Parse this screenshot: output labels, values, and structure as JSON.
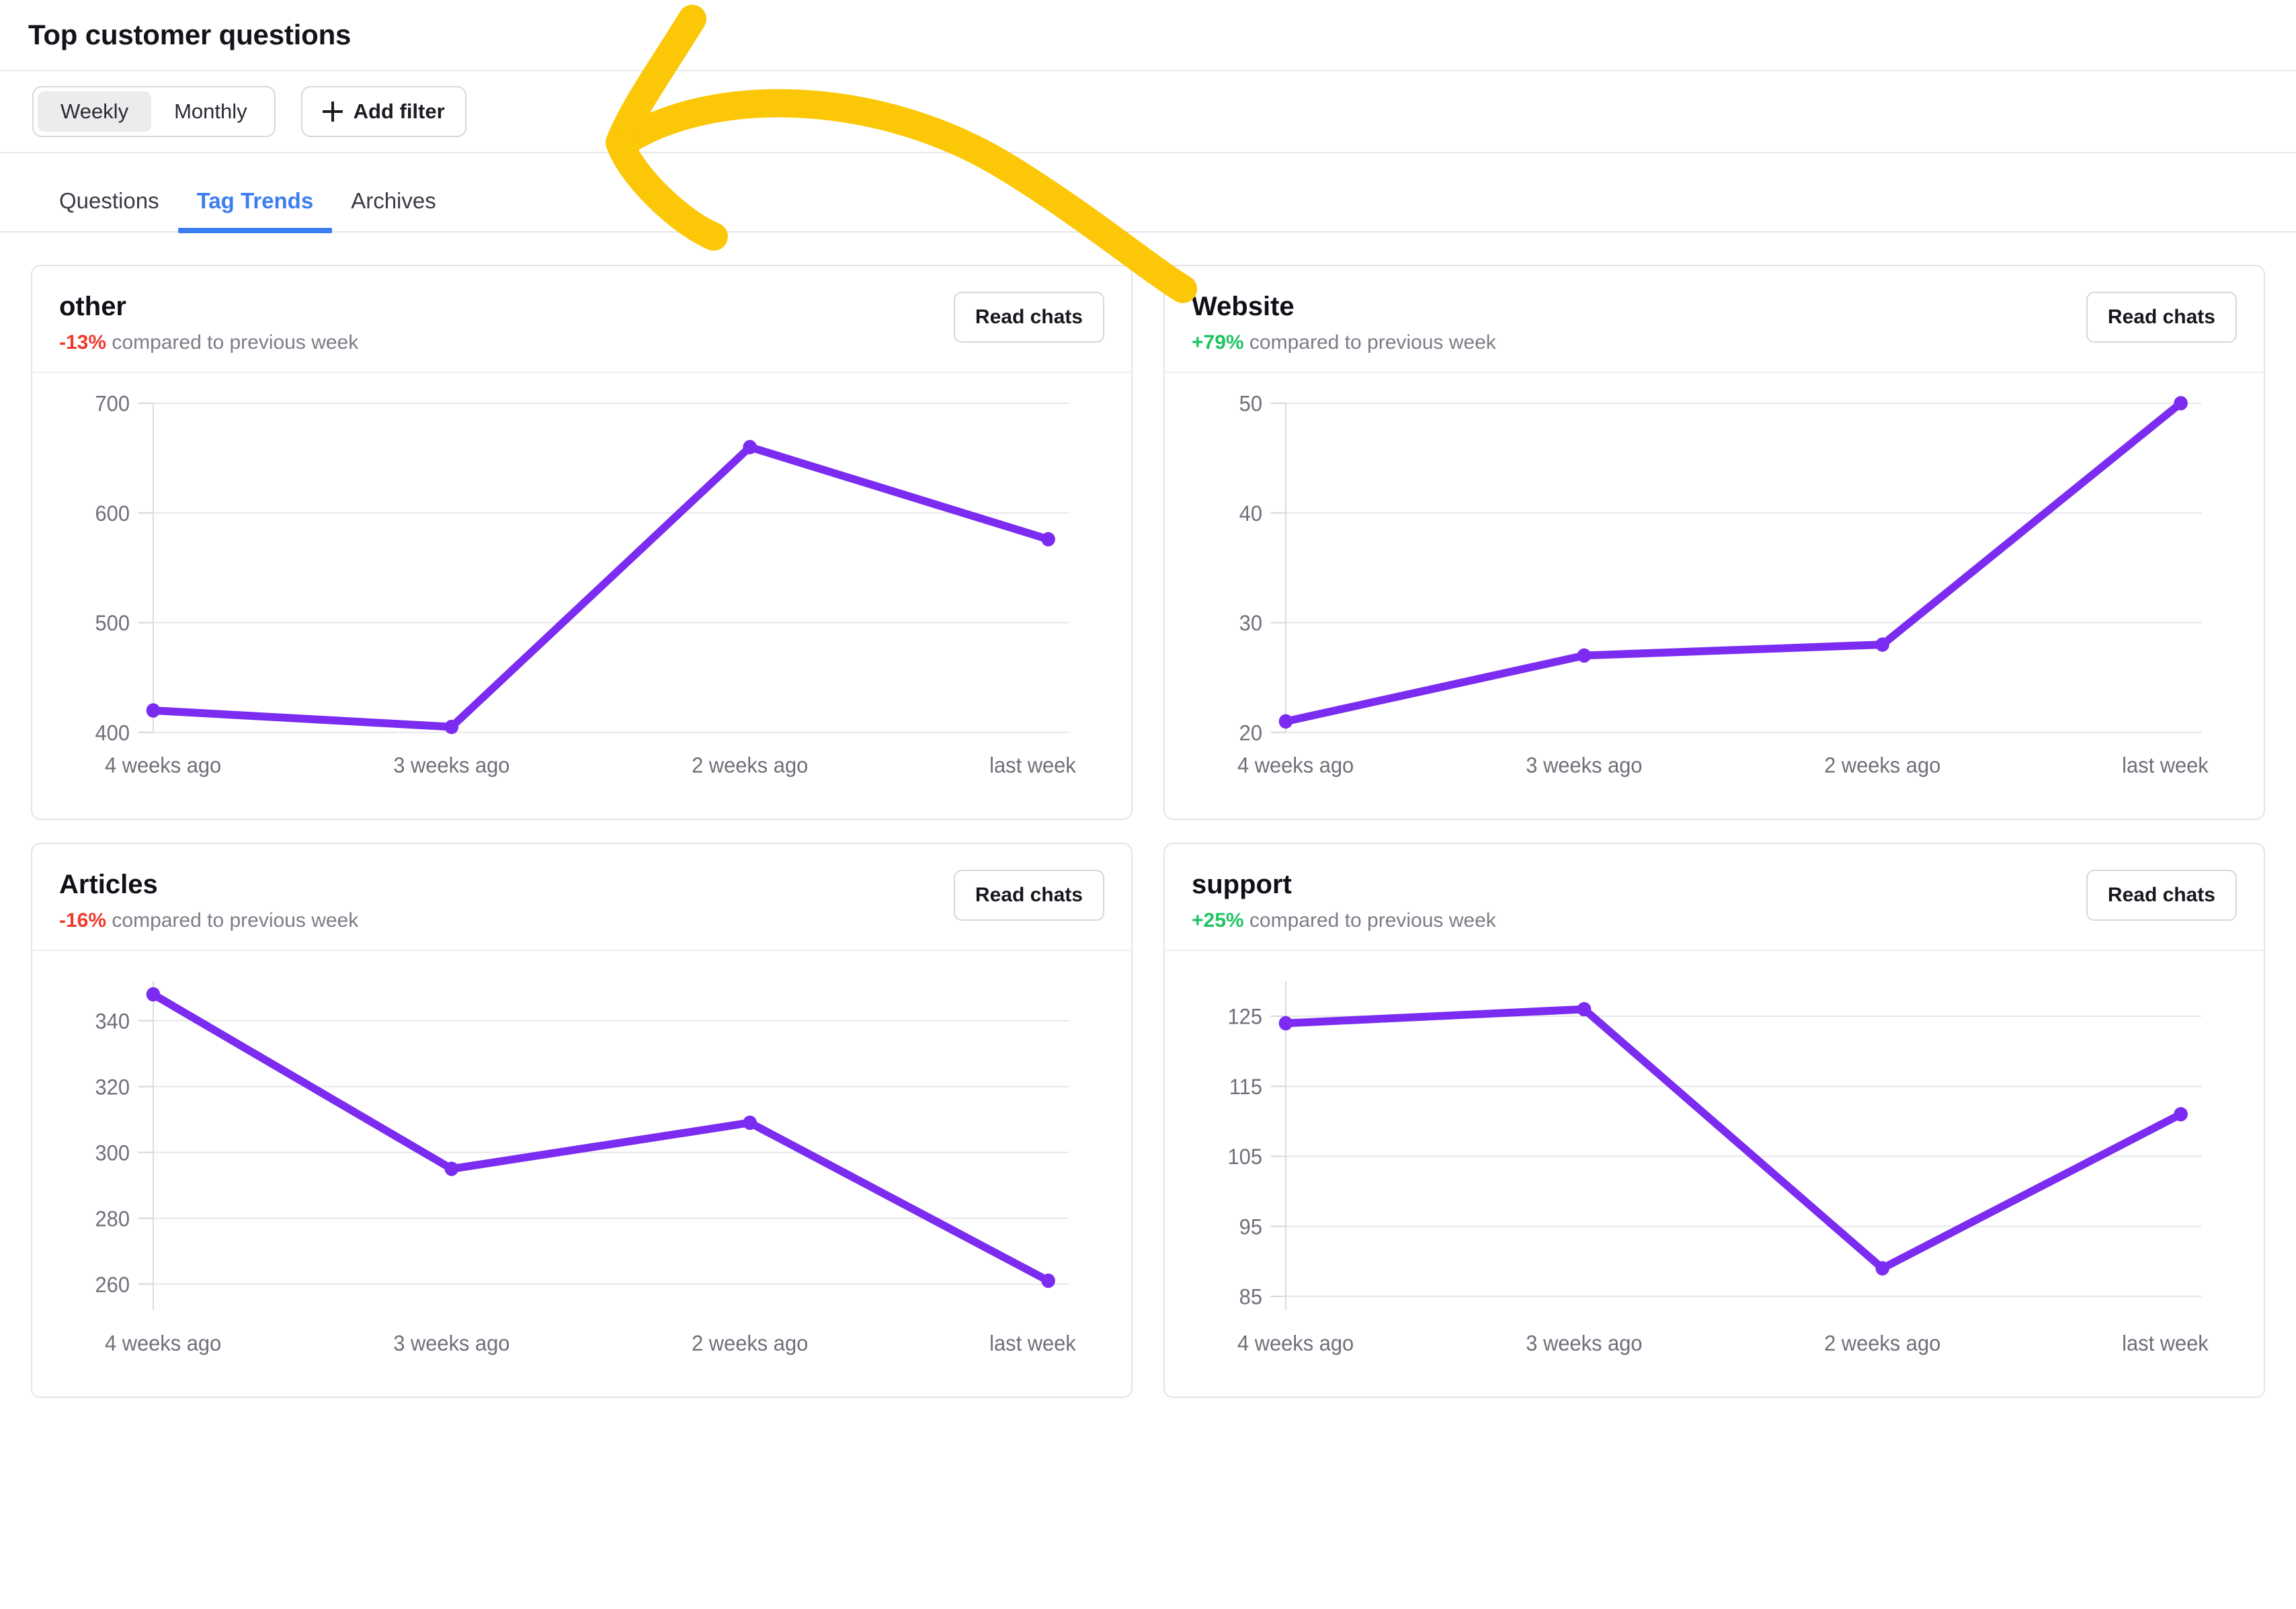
{
  "header": {
    "title": "Top customer questions"
  },
  "filters": {
    "segmented": {
      "options": [
        "Weekly",
        "Monthly"
      ],
      "selected": "Weekly"
    },
    "weekly_label": "Weekly",
    "monthly_label": "Monthly",
    "add_filter_label": "Add filter",
    "plus_icon": "plus-icon"
  },
  "tabs": [
    {
      "label": "Questions",
      "active": false
    },
    {
      "label": "Tag Trends",
      "active": true
    },
    {
      "label": "Archives",
      "active": false
    }
  ],
  "annotation": {
    "type": "hand-drawn-arrow",
    "color": "#FBC707",
    "points_to": "Add filter"
  },
  "colors": {
    "line": "#7B2CF0",
    "positive": "#1FC464",
    "negative": "#F0392B",
    "tab_active": "#3B7EF2",
    "annotation": "#FBC707"
  },
  "common": {
    "read_chats_label": "Read chats",
    "compare_text": "compared to previous week",
    "x_labels": [
      "4 weeks ago",
      "3 weeks ago",
      "2 weeks ago",
      "last week"
    ]
  },
  "cards": [
    {
      "title": "other",
      "delta": "-13%",
      "delta_sign": "neg",
      "compare": "compared to previous week",
      "read_chats": "Read chats"
    },
    {
      "title": "Website",
      "delta": "+79%",
      "delta_sign": "pos",
      "compare": "compared to previous week",
      "read_chats": "Read chats"
    },
    {
      "title": "Articles",
      "delta": "-16%",
      "delta_sign": "neg",
      "compare": "compared to previous week",
      "read_chats": "Read chats"
    },
    {
      "title": "support",
      "delta": "+25%",
      "delta_sign": "pos",
      "compare": "compared to previous week",
      "read_chats": "Read chats"
    }
  ],
  "chart_data": [
    {
      "type": "line",
      "title": "other",
      "x": [
        "4 weeks ago",
        "3 weeks ago",
        "2 weeks ago",
        "last week"
      ],
      "values": [
        420,
        405,
        660,
        576
      ],
      "yticks": [
        400,
        500,
        600,
        700
      ],
      "ylim": [
        400,
        700
      ],
      "xlabel": "",
      "ylabel": "",
      "grid": true,
      "legend": false,
      "line_color": "#7B2CF0"
    },
    {
      "type": "line",
      "title": "Website",
      "x": [
        "4 weeks ago",
        "3 weeks ago",
        "2 weeks ago",
        "last week"
      ],
      "values": [
        21,
        27,
        28,
        50
      ],
      "yticks": [
        20,
        30,
        40,
        50
      ],
      "ylim": [
        20,
        50
      ],
      "xlabel": "",
      "ylabel": "",
      "grid": true,
      "legend": false,
      "line_color": "#7B2CF0"
    },
    {
      "type": "line",
      "title": "Articles",
      "x": [
        "4 weeks ago",
        "3 weeks ago",
        "2 weeks ago",
        "last week"
      ],
      "values": [
        348,
        295,
        309,
        261
      ],
      "yticks": [
        260,
        280,
        300,
        320,
        340
      ],
      "ylim": [
        252,
        352
      ],
      "xlabel": "",
      "ylabel": "",
      "grid": true,
      "legend": false,
      "line_color": "#7B2CF0"
    },
    {
      "type": "line",
      "title": "support",
      "x": [
        "4 weeks ago",
        "3 weeks ago",
        "2 weeks ago",
        "last week"
      ],
      "values": [
        124,
        126,
        89,
        111
      ],
      "yticks": [
        85,
        95,
        105,
        115,
        125
      ],
      "ylim": [
        83,
        130
      ],
      "xlabel": "",
      "ylabel": "",
      "grid": true,
      "legend": false,
      "line_color": "#7B2CF0"
    }
  ]
}
